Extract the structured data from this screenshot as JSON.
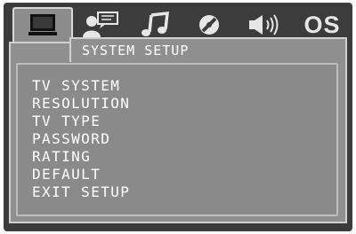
{
  "tabs": [
    {
      "icon": "monitor-icon",
      "label": "System"
    },
    {
      "icon": "user-speech-icon",
      "label": "Language"
    },
    {
      "icon": "music-note-icon",
      "label": "Audio"
    },
    {
      "icon": "video-disc-icon",
      "label": "Video"
    },
    {
      "icon": "speaker-icon",
      "label": "Speaker"
    },
    {
      "icon": "os-text",
      "label": "OS"
    }
  ],
  "selected_tab": 0,
  "header": {
    "title": "SYSTEM SETUP"
  },
  "menu": {
    "items": [
      {
        "label": "TV SYSTEM"
      },
      {
        "label": "RESOLUTION"
      },
      {
        "label": "TV TYPE"
      },
      {
        "label": "PASSWORD"
      },
      {
        "label": "RATING"
      },
      {
        "label": "DEFAULT"
      },
      {
        "label": "EXIT SETUP"
      }
    ]
  },
  "colors": {
    "frame": "#3c3c3c",
    "panel": "#8f8f8f",
    "text": "#ffffff",
    "icon": "#e6e6e6"
  }
}
